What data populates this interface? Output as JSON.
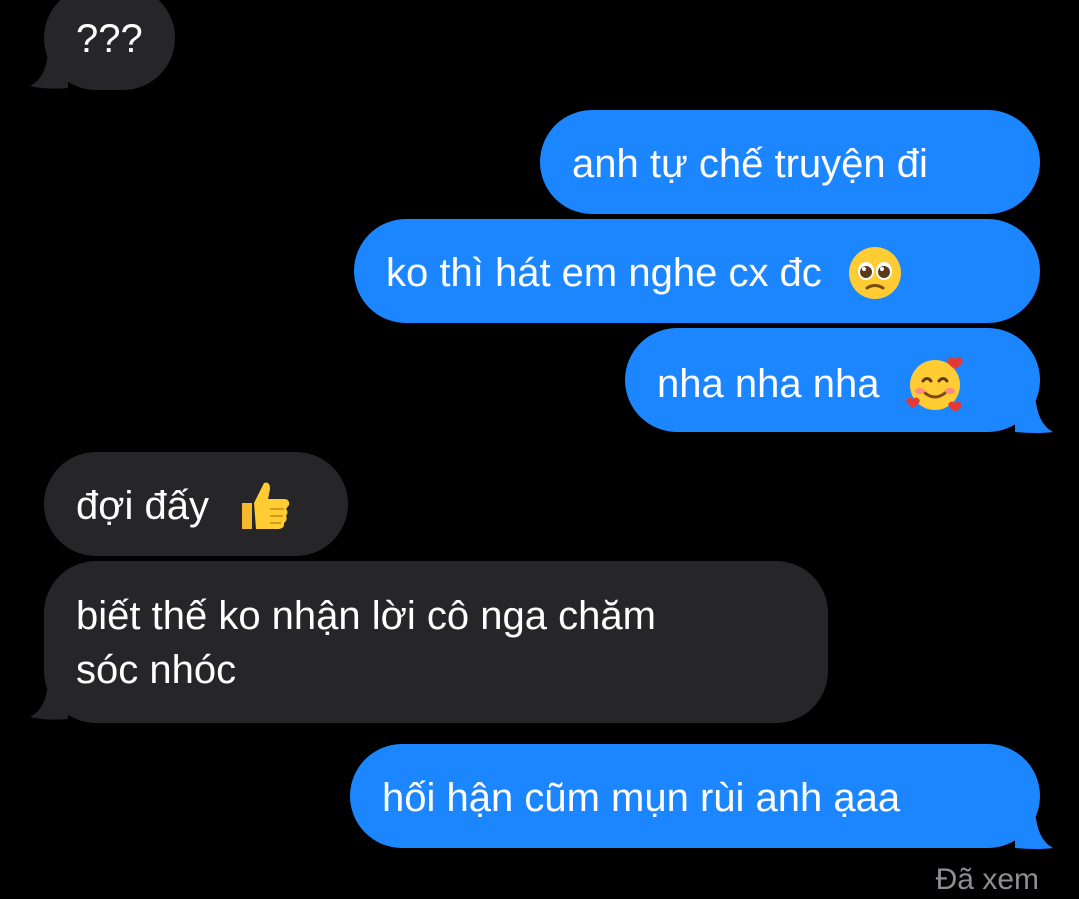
{
  "messages": [
    {
      "side": "incoming",
      "text": "???"
    },
    {
      "side": "outgoing",
      "text": "anh tự chế truyện đi"
    },
    {
      "side": "outgoing",
      "text": "ko thì hát em nghe cx đc",
      "emoji": "pleading-face-emoji"
    },
    {
      "side": "outgoing",
      "text": "nha nha nha",
      "emoji": "smiling-face-with-hearts-emoji"
    },
    {
      "side": "incoming",
      "text": "đợi đấy",
      "emoji": "thumbs-up-emoji"
    },
    {
      "side": "incoming",
      "text_lines": [
        "biết thế ko nhận lời cô nga chăm",
        "sóc nhóc"
      ]
    },
    {
      "side": "outgoing",
      "text": "hối hận cũm mụn rùi anh ạaa"
    }
  ],
  "status": {
    "seen_label": "Đã xem"
  },
  "colors": {
    "background": "#000000",
    "incoming_bubble": "#262628",
    "outgoing_bubble": "#1b86ff",
    "text": "#ffffff",
    "status_text": "#8e8e93"
  }
}
